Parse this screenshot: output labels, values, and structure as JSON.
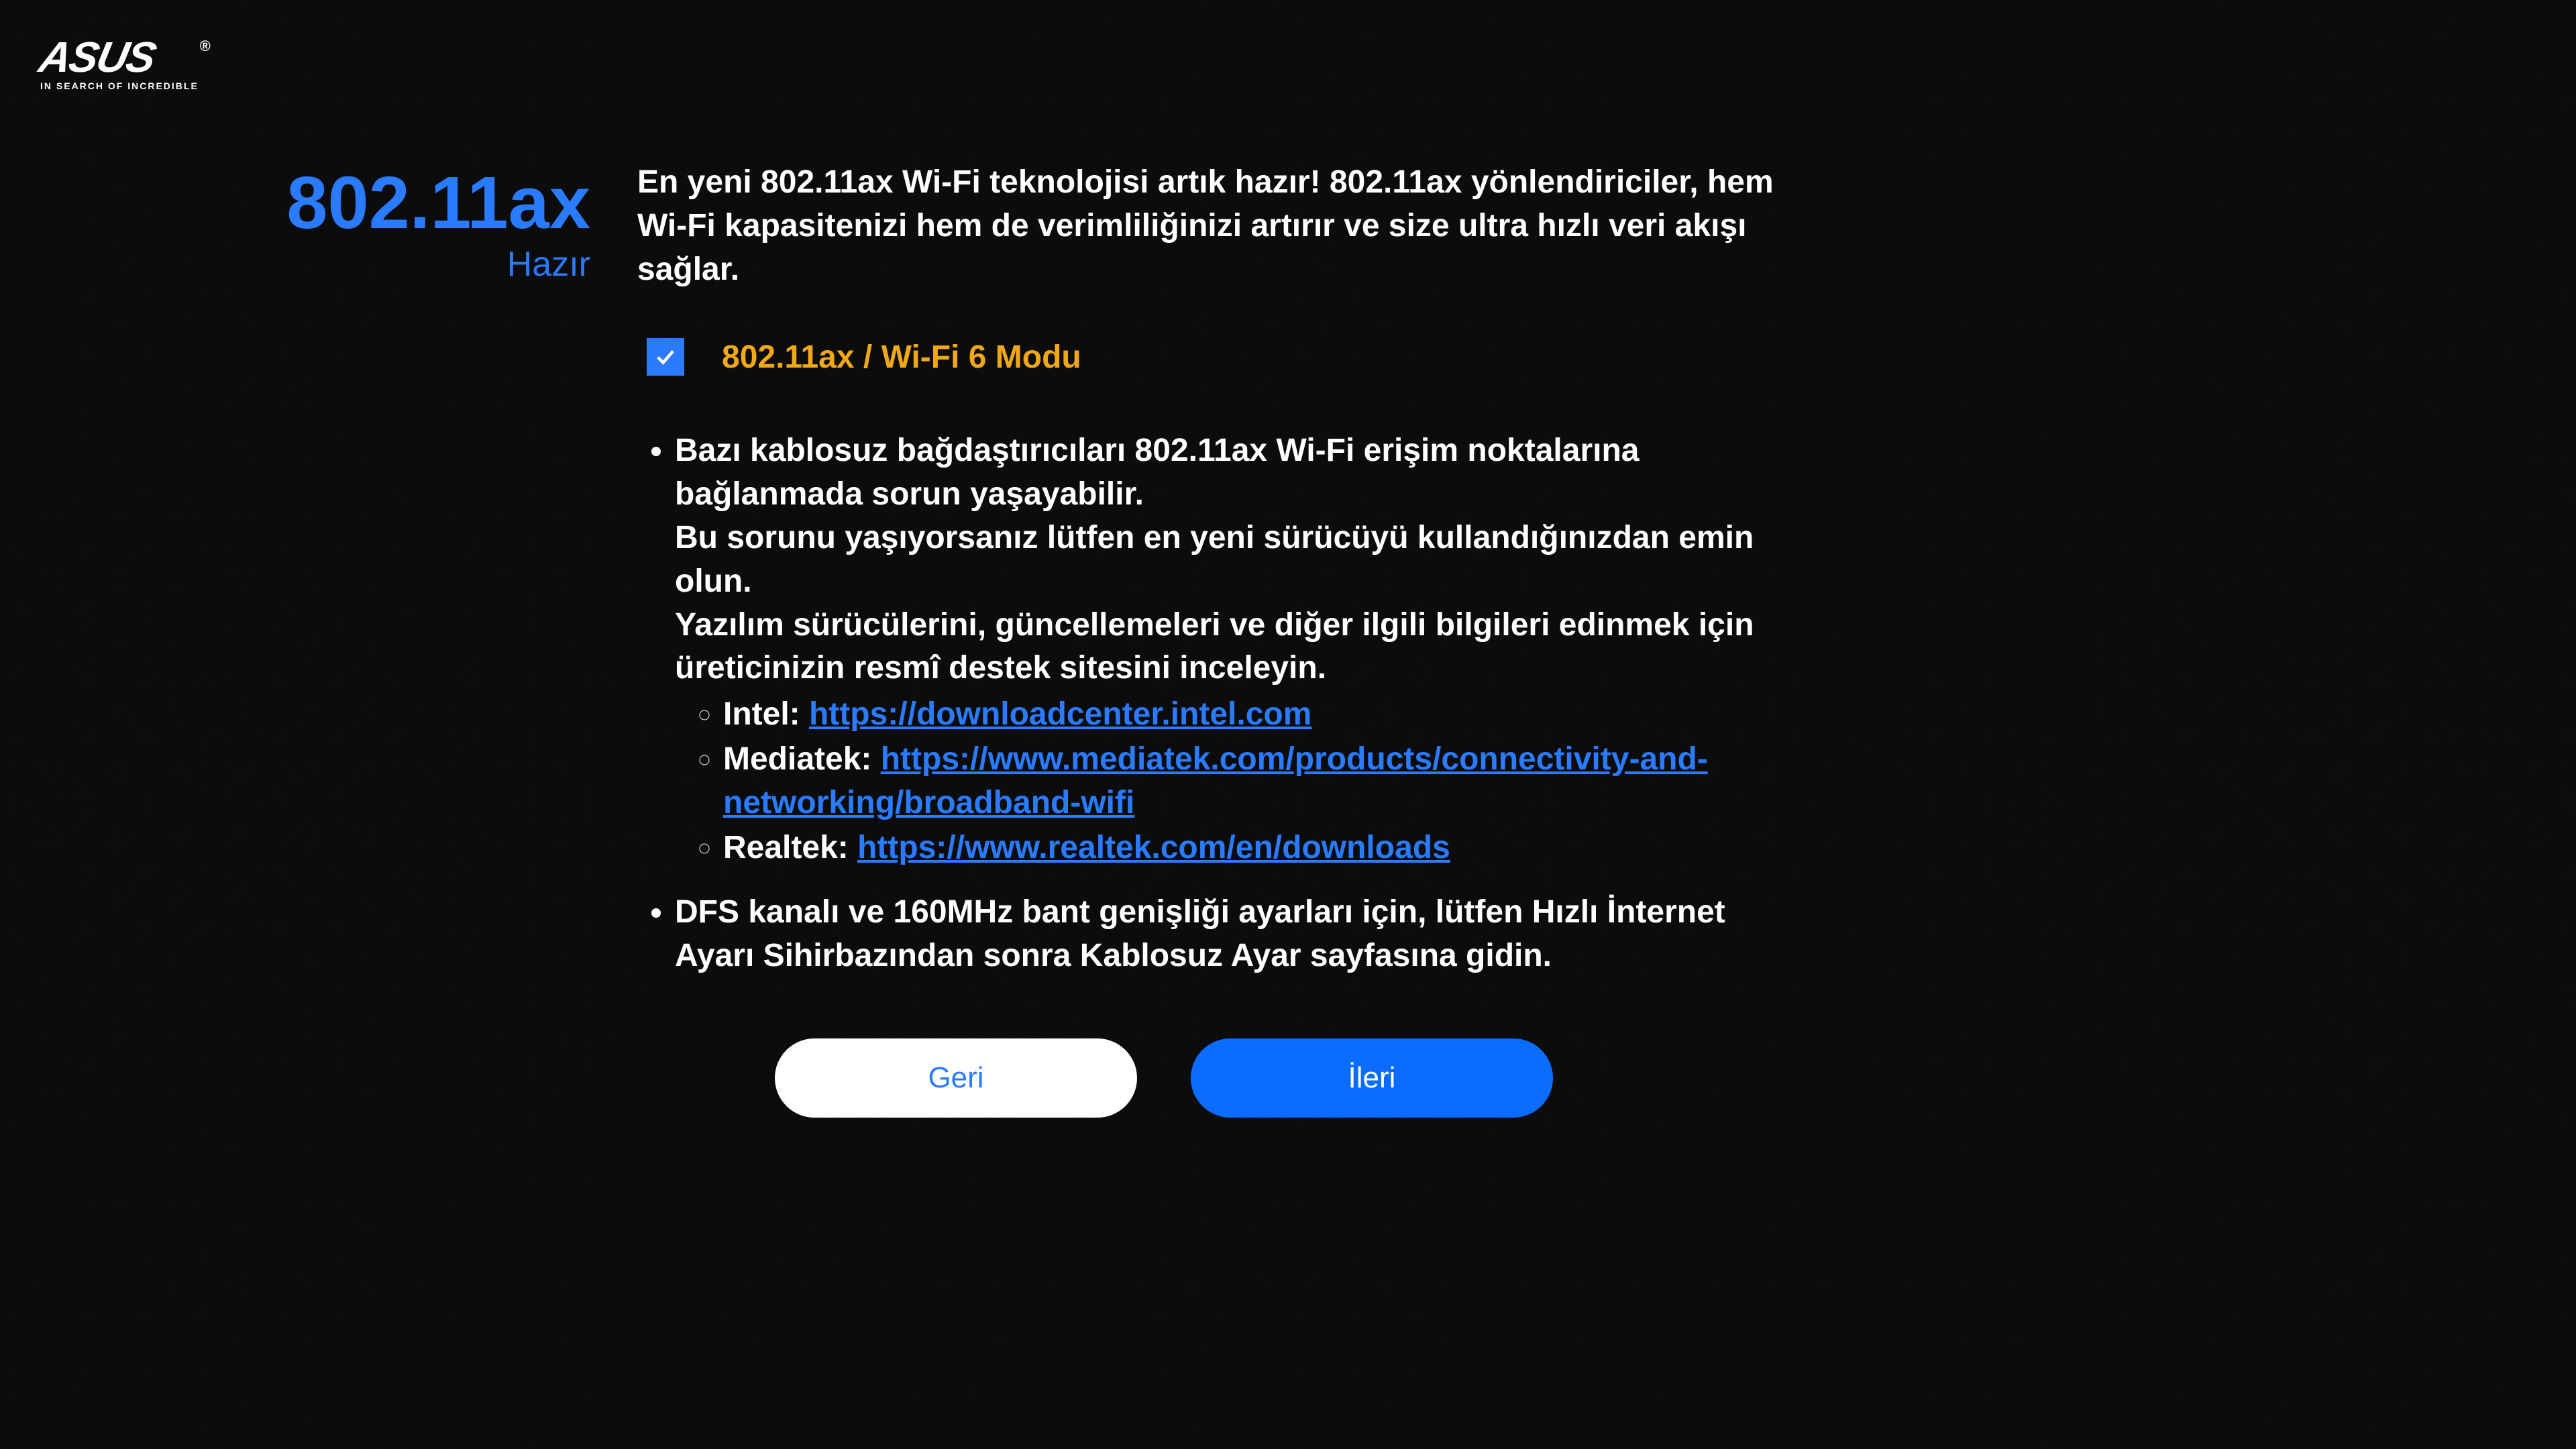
{
  "brand": {
    "name": "ASUS",
    "tagline": "IN SEARCH OF INCREDIBLE"
  },
  "header": {
    "title": "802.11ax",
    "subtitle": "Hazır"
  },
  "intro": "En yeni 802.11ax Wi-Fi teknolojisi artık hazır! 802.11ax yönlendiriciler, hem Wi-Fi kapasitenizi hem de verimliliğinizi artırır ve size ultra hızlı veri akışı sağlar.",
  "option": {
    "checked": true,
    "label": "802.11ax / Wi-Fi 6 Modu"
  },
  "bullets": {
    "b1_line1": "Bazı kablosuz bağdaştırıcıları 802.11ax Wi-Fi erişim noktalarına bağlanmada sorun yaşayabilir.",
    "b1_line2": "Bu sorunu yaşıyorsanız lütfen en yeni sürücüyü kullandığınızdan emin olun.",
    "b1_line3": "Yazılım sürücülerini, güncellemeleri ve diğer ilgili bilgileri edinmek için üreticinizin resmî destek sitesini inceleyin.",
    "drivers": [
      {
        "vendor": "Intel:",
        "url": "https://downloadcenter.intel.com"
      },
      {
        "vendor": "Mediatek:",
        "url": "https://www.mediatek.com/products/connectivity-and-networking/broadband-wifi"
      },
      {
        "vendor": "Realtek:",
        "url": "https://www.realtek.com/en/downloads"
      }
    ],
    "b2": "DFS kanalı ve 160MHz bant genişliği ayarları için, lütfen Hızlı İnternet Ayarı Sihirbazından sonra Kablosuz Ayar sayfasına gidin."
  },
  "buttons": {
    "back": "Geri",
    "next": "İleri"
  },
  "colors": {
    "accent": "#2a7bff",
    "warn": "#f0a818",
    "bg": "#0a0a0a"
  }
}
